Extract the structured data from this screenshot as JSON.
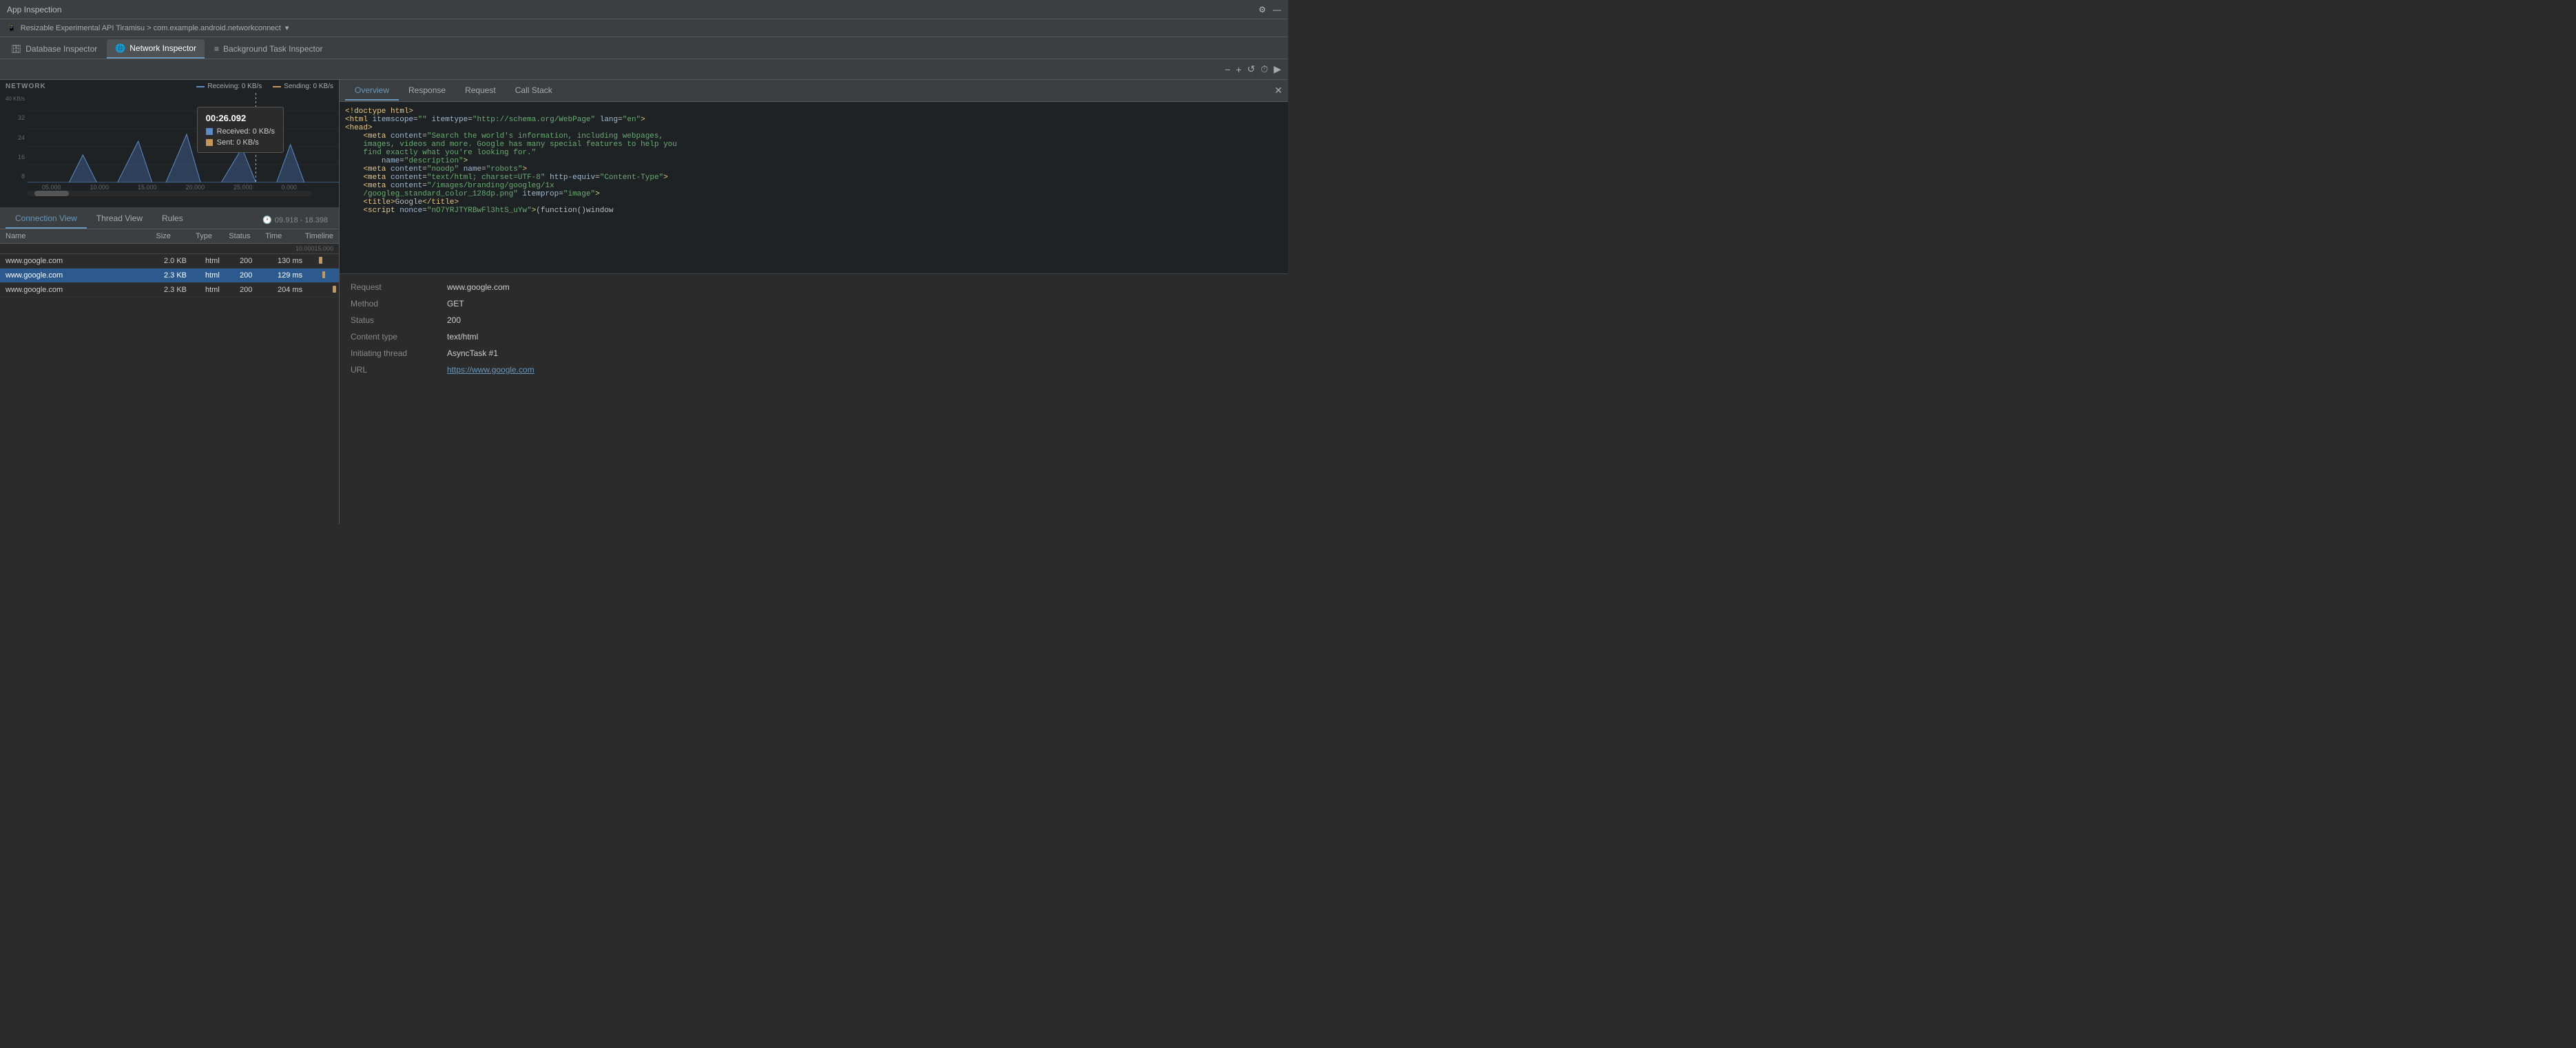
{
  "titleBar": {
    "title": "App Inspection",
    "settingsIcon": "⚙",
    "minimizeIcon": "—"
  },
  "breadcrumb": {
    "deviceIcon": "📱",
    "text": "Resizable Experimental API Tiramisu > com.example.android.networkconnect",
    "dropdownIcon": "▾"
  },
  "tabs": [
    {
      "id": "database",
      "label": "Database Inspector",
      "icon": "🗄",
      "active": false
    },
    {
      "id": "network",
      "label": "Network Inspector",
      "icon": "🌐",
      "active": true
    },
    {
      "id": "background",
      "label": "Background Task Inspector",
      "icon": "≡",
      "active": false
    }
  ],
  "toolbar": {
    "icons": [
      "−",
      "+",
      "↺",
      "⏱",
      "▶"
    ]
  },
  "chart": {
    "title": "NETWORK",
    "yLabels": [
      "40 KB/s",
      "32",
      "24",
      "16",
      "8"
    ],
    "xLabels": [
      "05.000",
      "10.000",
      "15.000",
      "20.000",
      "25.000",
      "0.000"
    ],
    "legend": {
      "receiving": "Receiving: 0 KB/s",
      "sending": "Sending: 0 KB/s"
    },
    "tooltip": {
      "time": "00:26.092",
      "received": "Received: 0 KB/s",
      "sent": "Sent: 0 KB/s"
    }
  },
  "subTabs": [
    {
      "id": "connection",
      "label": "Connection View",
      "active": true
    },
    {
      "id": "thread",
      "label": "Thread View",
      "active": false
    },
    {
      "id": "rules",
      "label": "Rules",
      "active": false
    }
  ],
  "timeRange": "09.918 - 18.398",
  "tableColumns": [
    "Name",
    "Size",
    "Type",
    "Status",
    "Time",
    "Timeline"
  ],
  "tableRows": [
    {
      "name": "www.google.com",
      "size": "2.0 KB",
      "type": "html",
      "status": "200",
      "time": "130 ms",
      "selected": false,
      "barOffset": 22,
      "barWidth": 14,
      "barColor": "#c8975b"
    },
    {
      "name": "www.google.com",
      "size": "2.3 KB",
      "type": "html",
      "status": "200",
      "time": "129 ms",
      "selected": true,
      "barOffset": 35,
      "barWidth": 12,
      "barColor": "#c8975b"
    },
    {
      "name": "www.google.com",
      "size": "2.3 KB",
      "type": "html",
      "status": "200",
      "time": "204 ms",
      "selected": false,
      "barOffset": 75,
      "barWidth": 14,
      "barColor": "#c8975b"
    }
  ],
  "rightPanel": {
    "tabs": [
      {
        "id": "overview",
        "label": "Overview",
        "active": true
      },
      {
        "id": "response",
        "label": "Response",
        "active": false
      },
      {
        "id": "request",
        "label": "Request",
        "active": false
      },
      {
        "id": "callstack",
        "label": "Call Stack",
        "active": false
      }
    ],
    "codeLines": [
      "<!doctype html>",
      "<html itemscope=\"\" itemtype=\"http://schema.org/WebPage\" lang=\"en\">",
      "<head>",
      "    <meta content=\"Search the world's information, including webpages,",
      "    images, videos and more. Google has many special features to help you",
      "    find exactly what you're looking for.\"",
      "        name=\"description\">",
      "    <meta content=\"noodp\" name=\"robots\">",
      "    <meta content=\"text/html; charset=UTF-8\" http-equiv=\"Content-Type\">",
      "    <meta content=\"/images/branding/googleg/1x",
      "    /googleg_standard_color_128dp.png\" itemprop=\"image\">",
      "    <title>Google</title>",
      "    <script nonce=\"nO7YRJTYRBwFl3htS_uYw\">(function()window"
    ],
    "details": [
      {
        "label": "Request",
        "value": "www.google.com",
        "isLink": false
      },
      {
        "label": "Method",
        "value": "GET",
        "isLink": false
      },
      {
        "label": "Status",
        "value": "200",
        "isLink": false
      },
      {
        "label": "Content type",
        "value": "text/html",
        "isLink": false
      },
      {
        "label": "Initiating thread",
        "value": "AsyncTask #1",
        "isLink": false
      },
      {
        "label": "URL",
        "value": "https://www.google.com",
        "isLink": true
      }
    ]
  }
}
